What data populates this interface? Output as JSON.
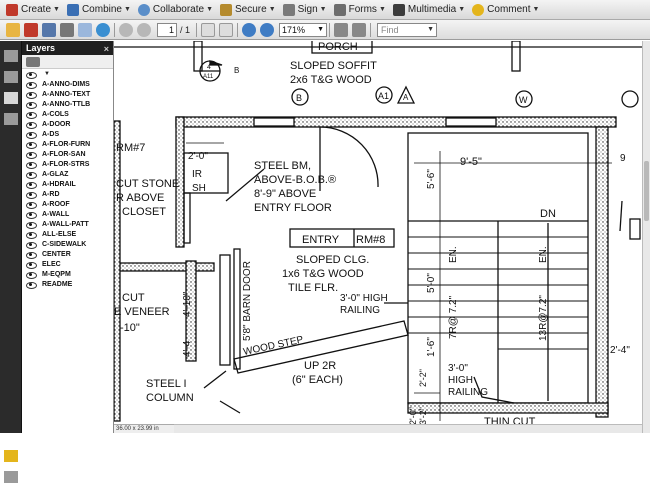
{
  "toolbar": {
    "create": "Create",
    "combine": "Combine",
    "collaborate": "Collaborate",
    "secure": "Secure",
    "sign": "Sign",
    "forms": "Forms",
    "multimedia": "Multimedia",
    "comment": "Comment"
  },
  "nav": {
    "page_number": "1",
    "page_total": "/ 1",
    "zoom": "171%",
    "find_placeholder": "Find"
  },
  "layers_panel": {
    "title": "Layers",
    "close": "×",
    "items": [
      "A-ANNO-DIMS",
      "A-ANNO-TEXT",
      "A-ANNO-TTLB",
      "A-COLS",
      "A-DOOR",
      "A-DS",
      "A-FLOR-FURN",
      "A-FLOR-SAN",
      "A-FLOR-STRS",
      "A-GLAZ",
      "A-HDRAIL",
      "A-RD",
      "A-ROOF",
      "A-WALL",
      "A-WALL-PATT",
      "ALL-ELSE",
      "C-SIDEWALK",
      "CENTER",
      "ELEC",
      "M-EQPM",
      "README"
    ]
  },
  "status": {
    "page_size": "36.00 x 23.99 in"
  },
  "drawing": {
    "porch": "PORCH",
    "sloped_soffit": "SLOPED SOFFIT",
    "tg_wood": "2x6 T&G WOOD",
    "tag_b": "B",
    "tag_a1": "A1",
    "tag_a": "A",
    "tag_w": "W",
    "section_num": "4",
    "section_sheet": "A11",
    "section_side": "B",
    "rm7": "RM#7",
    "dim_2_0": "2'-0\"",
    "ir": "IR",
    "sh": "SH",
    "steel_bm": "STEEL BM,",
    "above_bob": "ABOVE-B.O.B.®",
    "dim_8_9": "8'-9\" ABOVE",
    "entry_floor": "ENTRY FLOOR",
    "cut_stone": "CUT STONE",
    "r_above": "R ABOVE",
    "closet": "CLOSET",
    "entry": "ENTRY",
    "rm8": "RM#8",
    "sloped_clg": "SLOPED CLG.",
    "tg_wood2": "1x6 T&G WOOD",
    "tile_flr": "TILE FLR.",
    "high_railing1": "3'-0\" HIGH",
    "railing": "RAILING",
    "dim_9_5": "9'-5\"",
    "dim_9": "9",
    "dn": "DN",
    "dim_5_6": "5'-6\"",
    "dim_5_0": "5'-0\"",
    "dim_1_6": "1'-6\"",
    "en1": "EN.",
    "en2": "EN.",
    "r_7_2": "7R@ 7.2\"",
    "r_13": "13R@7.2\"",
    "barn_door": "5'8\" BARN DOOR",
    "dim_4_10": "4'-10\"",
    "dim_4_4": "4'-4",
    "cut": "CUT",
    "veneer": "E VENEER",
    "dim_10": "-10\"",
    "wood_step": "WOOD STEP",
    "up_2r": "UP 2R",
    "each": "(6\" EACH)",
    "steel_i": "STEEL I",
    "column": "COLUMN",
    "high_railing2": "3'-0\"",
    "high2": "HIGH",
    "railing2": "RAILING",
    "dim_2_4": "2'-4\"",
    "thin_cut": "THIN CUT",
    "dim_3_2": "3'-2\"",
    "dim_3_2b": "2'-2\"",
    "dim_2_0b": "2'-0\""
  }
}
